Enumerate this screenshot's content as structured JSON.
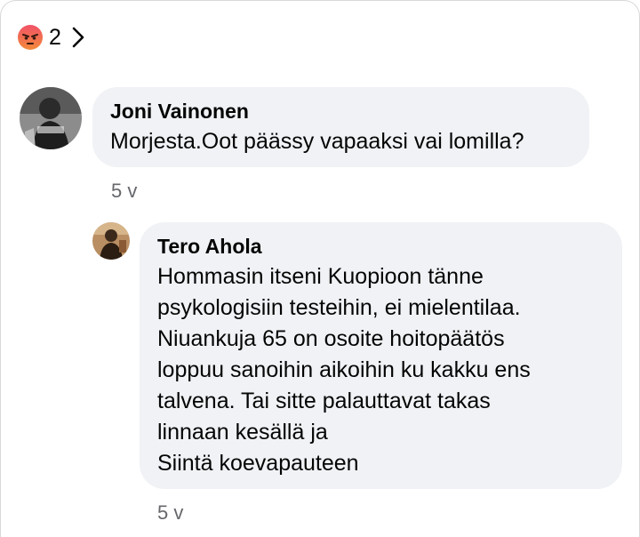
{
  "reactions": {
    "icon": "angry-face-icon",
    "count": "2"
  },
  "comments": [
    {
      "author": "Joni Vainonen",
      "text": "Morjesta.Oot päässy vapaaksi vai lomilla?",
      "time": "5 v"
    },
    {
      "author": "Tero Ahola",
      "text": "Hommasin itseni Kuopioon tänne\npsykologisiin testeihin, ei mielentilaa.\nNiuankuja 65 on osoite hoitopäätös\nloppuu sanoihin aikoihin ku kakku ens\ntalvena. Tai sitte palauttavat takas\nlinnaan kesällä ja\nSiintä koevapauteen",
      "time": "5 v"
    }
  ],
  "colors": {
    "bubble": "#f0f2f5",
    "text": "#050505",
    "meta": "#65676b",
    "angry": "#e9710f"
  }
}
